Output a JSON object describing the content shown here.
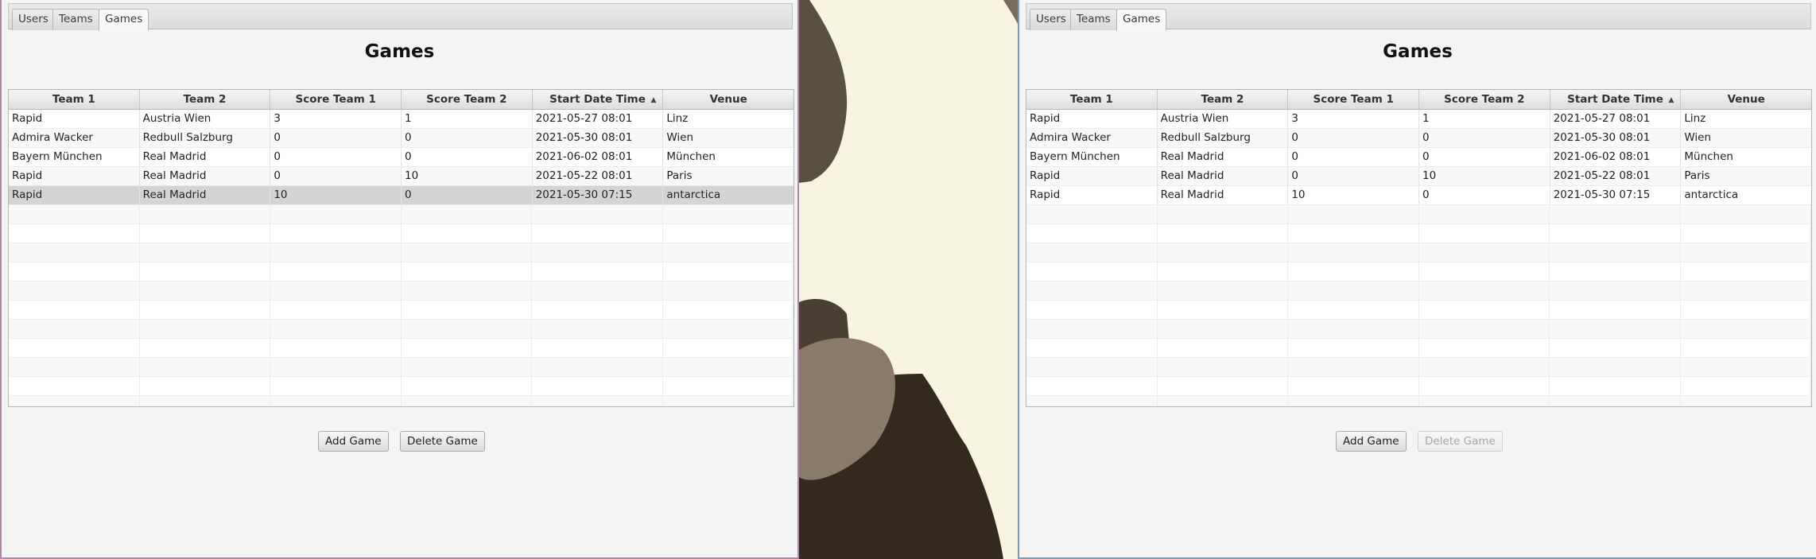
{
  "tabs": [
    "Users",
    "Teams",
    "Games"
  ],
  "active_tab": "Games",
  "title": "Games",
  "columns": [
    "Team 1",
    "Team 2",
    "Score Team 1",
    "Score Team 2",
    "Start Date Time",
    "Venue"
  ],
  "sort_indicator": "▲",
  "rows": [
    [
      "Rapid",
      "Austria Wien",
      "3",
      "1",
      "2021-05-27 08:01",
      "Linz"
    ],
    [
      "Admira Wacker",
      "Redbull Salzburg",
      "0",
      "0",
      "2021-05-30 08:01",
      "Wien"
    ],
    [
      "Bayern München",
      "Real Madrid",
      "0",
      "0",
      "2021-06-02 08:01",
      "München"
    ],
    [
      "Rapid",
      "Real Madrid",
      "0",
      "10",
      "2021-05-22 08:01",
      "Paris"
    ],
    [
      "Rapid",
      "Real Madrid",
      "10",
      "0",
      "2021-05-30 07:15",
      "antarctica"
    ]
  ],
  "buttons": {
    "add": "Add Game",
    "delete": "Delete Game"
  },
  "left_window": {
    "selected_row": 4,
    "delete_enabled": true
  },
  "right_window": {
    "selected_row": null,
    "delete_enabled": false
  },
  "colors": {
    "left_border": "#b089aa",
    "right_border": "#7c98ad",
    "background": "#f7f4df"
  }
}
